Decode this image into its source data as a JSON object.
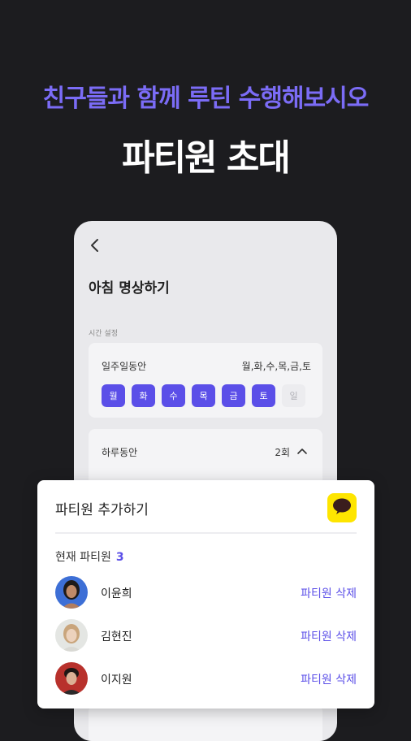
{
  "promo": {
    "subtitle": "친구들과 함께 루틴 수행해보시오",
    "title": "파티원 초대"
  },
  "screen": {
    "title": "아침 명상하기",
    "section_label": "시간 설정",
    "week": {
      "label": "일주일동안",
      "value": "월,화,수,목,금,토",
      "days": [
        {
          "label": "월",
          "selected": true
        },
        {
          "label": "화",
          "selected": true
        },
        {
          "label": "수",
          "selected": true
        },
        {
          "label": "목",
          "selected": true
        },
        {
          "label": "금",
          "selected": true
        },
        {
          "label": "토",
          "selected": true
        },
        {
          "label": "일",
          "selected": false
        }
      ]
    },
    "daily": {
      "label": "하루동안",
      "value": "2회"
    }
  },
  "sheet": {
    "title": "파티원 추가하기",
    "current_label": "현재 파티원",
    "current_count": "3",
    "members": [
      {
        "name": "이윤희",
        "action": "파티원 삭제"
      },
      {
        "name": "김현진",
        "action": "파티원 삭제"
      },
      {
        "name": "이지원",
        "action": "파티원 삭제"
      }
    ]
  },
  "colors": {
    "accent": "#5b4fe8",
    "promo_accent": "#7b6cf6",
    "background": "#1c1c1f",
    "kakao": "#fee500"
  },
  "icons": [
    "back-arrow-icon",
    "chevron-up-icon",
    "kakao-chat-icon"
  ]
}
